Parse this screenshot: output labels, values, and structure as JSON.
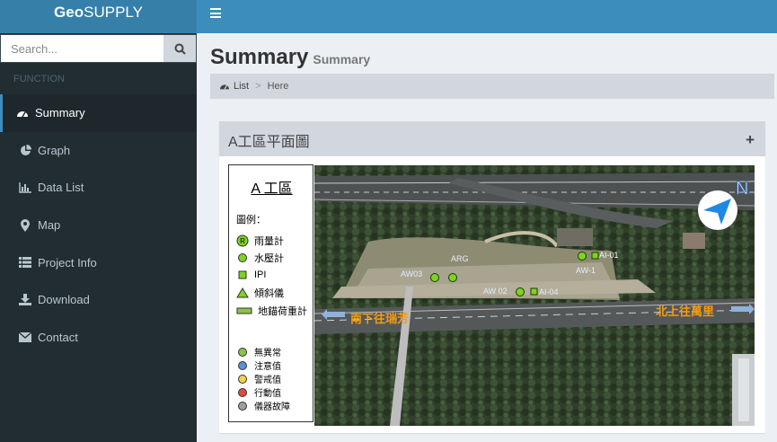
{
  "app": {
    "logo_prefix": "Geo",
    "logo_suffix": "SUPPLY"
  },
  "search": {
    "placeholder": "Search..."
  },
  "sidebar": {
    "header": "FUNCTION",
    "items": [
      {
        "label": "Summary",
        "icon": "dashboard-icon",
        "active": true
      },
      {
        "label": "Graph",
        "icon": "pie-chart-icon"
      },
      {
        "label": "Data List",
        "icon": "bar-chart-icon"
      },
      {
        "label": "Map",
        "icon": "map-marker-icon"
      },
      {
        "label": "Project Info",
        "icon": "list-icon"
      },
      {
        "label": "Download",
        "icon": "download-icon"
      },
      {
        "label": "Contact",
        "icon": "envelope-icon"
      }
    ]
  },
  "page": {
    "title": "Summary",
    "subtitle": "Summary"
  },
  "breadcrumb": {
    "list": "List",
    "separator": ">",
    "here": "Here"
  },
  "box": {
    "title": "A工區平面圖",
    "tool": "+",
    "legend": {
      "title": "A 工區",
      "heading": "圖例：",
      "types": [
        {
          "label": "雨量計",
          "icon": "rain-gauge-icon",
          "mark": "R"
        },
        {
          "label": "水壓計",
          "icon": "piezometer-icon"
        },
        {
          "label": "IPI",
          "icon": "ipi-icon"
        },
        {
          "label": "傾斜儀",
          "icon": "tiltmeter-icon"
        },
        {
          "label": "地錨荷重計",
          "icon": "anchor-load-icon"
        }
      ],
      "statuses": [
        {
          "label": "無異常",
          "color": "#8bc34a"
        },
        {
          "label": "注意值",
          "color": "#5c8fd6"
        },
        {
          "label": "警戒值",
          "color": "#f2d14a"
        },
        {
          "label": "行動值",
          "color": "#e04a3a"
        },
        {
          "label": "儀器故障",
          "color": "#9e9e9e"
        }
      ]
    },
    "map": {
      "north": "N",
      "labels": {
        "aw03": "AW03",
        "arg": "ARG",
        "aw02": "AW 02",
        "ai04": "AI-04",
        "ai01": "AI-01",
        "aw1": "AW-1"
      },
      "dir_south": "南下往瑞芳",
      "dir_north": "北上往萬里"
    }
  },
  "colors": {
    "topbar": "#3c8dbc",
    "sidebar": "#222d32",
    "accent_orange": "#f39c12",
    "sensor_green": "#7ed321"
  }
}
